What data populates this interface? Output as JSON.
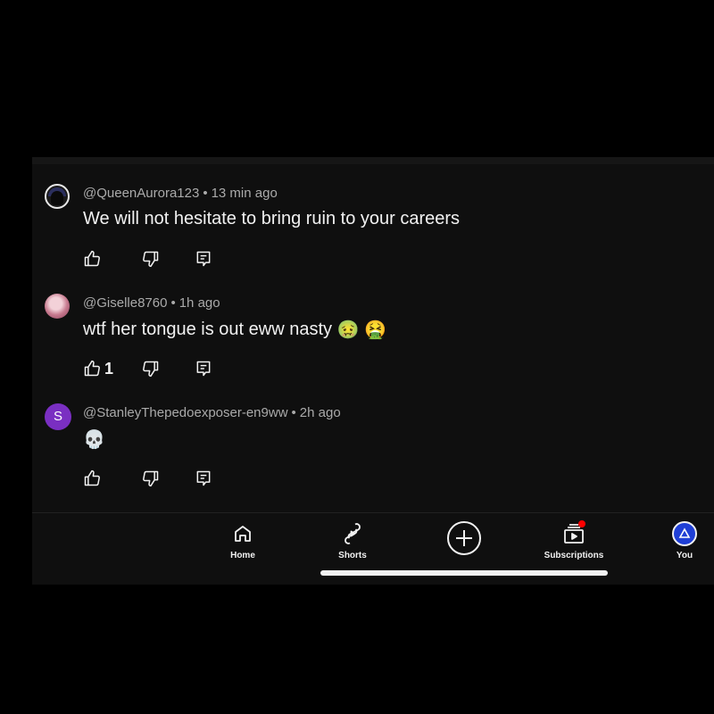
{
  "comments": [
    {
      "username": "@QueenAurora123",
      "time": "13 min ago",
      "text": "We will not hesitate to bring ruin to your careers",
      "likes": "",
      "avatar": "anime-avatar"
    },
    {
      "username": "@Giselle8760",
      "time": "1h ago",
      "text": "wtf her tongue is out eww nasty",
      "emojis": [
        "🤢",
        "🤮"
      ],
      "likes": "1",
      "avatar": "photo-avatar"
    },
    {
      "username": "@StanleyThepedoexposer-en9ww",
      "time": "2h ago",
      "text": "💀",
      "likes": "",
      "avatar_letter": "S",
      "avatar_color": "#7a2fc2"
    }
  ],
  "nav": {
    "home": "Home",
    "shorts": "Shorts",
    "create_icon": "plus-circle-icon",
    "subscriptions": "Subscriptions",
    "you": "You"
  },
  "colors": {
    "background": "#0f0f0f",
    "text_primary": "#f1f1f1",
    "text_secondary": "#aaaaaa",
    "notification_dot": "#ff0000",
    "you_avatar": "#1f3fd6"
  },
  "separator": "•"
}
